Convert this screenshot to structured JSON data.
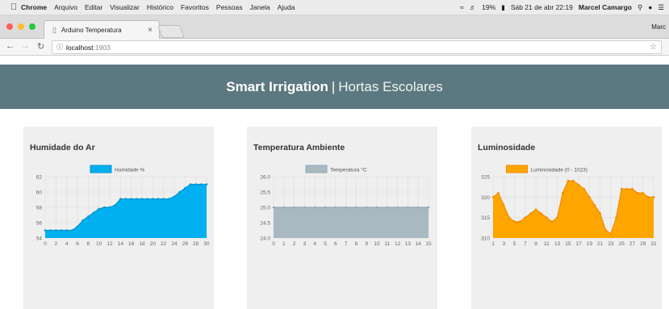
{
  "menubar": {
    "apple": "",
    "app": "Chrome",
    "items": [
      "Arquivo",
      "Editar",
      "Visualizar",
      "Histórico",
      "Favoritos",
      "Pessoas",
      "Janela",
      "Ajuda"
    ],
    "battery": "19%",
    "datetime": "Sáb 21 de abr 22:19",
    "user": "Marcel Camargo"
  },
  "browser": {
    "tab_title": "Arduino Temperatura",
    "profile": "Marc",
    "url_host": "localhost",
    "url_port": ":1903"
  },
  "banner": {
    "title_bold": "Smart Irrigation",
    "separator": "|",
    "title_light": "Hortas Escolares"
  },
  "colors": {
    "banner": "#5c7880",
    "humidity": "#00b0f0",
    "temperature": "#a8b9c2",
    "luminosity": "#ffa500"
  },
  "cards": [
    {
      "title": "Humidade do Ar"
    },
    {
      "title": "Temperatura Ambiente"
    },
    {
      "title": "Luminosidade"
    }
  ],
  "chart_data": [
    {
      "type": "area",
      "legend": "Humidade %",
      "ylim": [
        54,
        62
      ],
      "yticks": [
        54,
        56,
        58,
        60,
        62
      ],
      "x": [
        0,
        1,
        2,
        3,
        4,
        5,
        6,
        7,
        8,
        9,
        10,
        11,
        12,
        13,
        14,
        15,
        16,
        17,
        18,
        19,
        20,
        21,
        22,
        23,
        24,
        25,
        26,
        27,
        28,
        29,
        30
      ],
      "xticks": [
        0,
        2,
        4,
        6,
        8,
        10,
        12,
        14,
        16,
        18,
        20,
        22,
        24,
        26,
        28,
        30
      ],
      "values": [
        55,
        55,
        55,
        55,
        55,
        55,
        55.5,
        56.3,
        56.8,
        57.3,
        57.8,
        58,
        58,
        58.3,
        59.1,
        59.1,
        59.1,
        59.1,
        59.1,
        59.1,
        59.1,
        59.1,
        59.1,
        59.1,
        59.4,
        60,
        60.5,
        61,
        61,
        61,
        61
      ],
      "color": "#00b0f0",
      "line_color": "#0095d0"
    },
    {
      "type": "area",
      "legend": "Temperatura °C",
      "ylim": [
        24,
        26
      ],
      "yticks": [
        "24.0",
        "24.5",
        "25.0",
        "25.5",
        "26.0"
      ],
      "x": [
        0,
        1,
        2,
        3,
        4,
        5,
        6,
        7,
        8,
        9,
        10,
        11,
        12,
        13,
        14,
        15
      ],
      "xticks": [
        0,
        1,
        2,
        3,
        4,
        5,
        6,
        7,
        8,
        9,
        10,
        11,
        12,
        13,
        14,
        15
      ],
      "values": [
        25,
        25,
        25,
        25,
        25,
        25,
        25,
        25,
        25,
        25,
        25,
        25,
        25,
        25,
        25,
        25
      ],
      "color": "#a8b9c2",
      "line_color": "#93a6b0"
    },
    {
      "type": "area",
      "legend": "Luminosidade (0 - 1023)",
      "ylim": [
        310,
        325
      ],
      "yticks": [
        310,
        315,
        320,
        325
      ],
      "x": [
        1,
        2,
        3,
        4,
        5,
        6,
        7,
        8,
        9,
        10,
        11,
        12,
        13,
        14,
        15,
        16,
        17,
        18,
        19,
        20,
        21,
        22,
        23,
        24,
        25,
        26,
        27,
        28,
        29,
        30,
        31
      ],
      "xticks": [
        1,
        3,
        5,
        7,
        9,
        11,
        13,
        15,
        17,
        19,
        21,
        23,
        25,
        27,
        29,
        31
      ],
      "values": [
        320,
        321,
        318,
        315,
        314,
        314,
        315,
        316,
        317,
        316,
        315,
        314,
        315,
        321,
        324,
        324,
        323,
        322,
        320,
        318,
        316,
        312,
        311,
        315,
        322,
        322,
        322,
        321,
        321,
        320,
        320
      ],
      "color": "#ffa500",
      "line_color": "#f08c00"
    }
  ]
}
